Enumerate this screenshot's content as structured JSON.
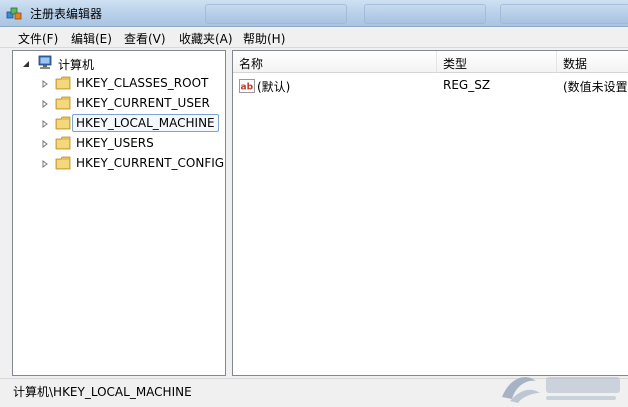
{
  "window": {
    "title": "注册表编辑器"
  },
  "menu": [
    {
      "label": "文件(F)"
    },
    {
      "label": "编辑(E)"
    },
    {
      "label": "查看(V)"
    },
    {
      "label": "收藏夹(A)"
    },
    {
      "label": "帮助(H)"
    }
  ],
  "tree": {
    "root": "计算机",
    "items": [
      {
        "label": "HKEY_CLASSES_ROOT"
      },
      {
        "label": "HKEY_CURRENT_USER"
      },
      {
        "label": "HKEY_LOCAL_MACHINE"
      },
      {
        "label": "HKEY_USERS"
      },
      {
        "label": "HKEY_CURRENT_CONFIG"
      }
    ]
  },
  "list": {
    "columns": [
      "名称",
      "类型",
      "数据"
    ],
    "rows": [
      {
        "name": "(默认)",
        "type": "REG_SZ",
        "data": "(数值未设置"
      }
    ]
  },
  "status": {
    "path": "计算机\\HKEY_LOCAL_MACHINE"
  },
  "colors": {
    "selection_border": "#7da2ce",
    "folder": "#e8c15a",
    "titlebar": "#b9d1ea"
  }
}
